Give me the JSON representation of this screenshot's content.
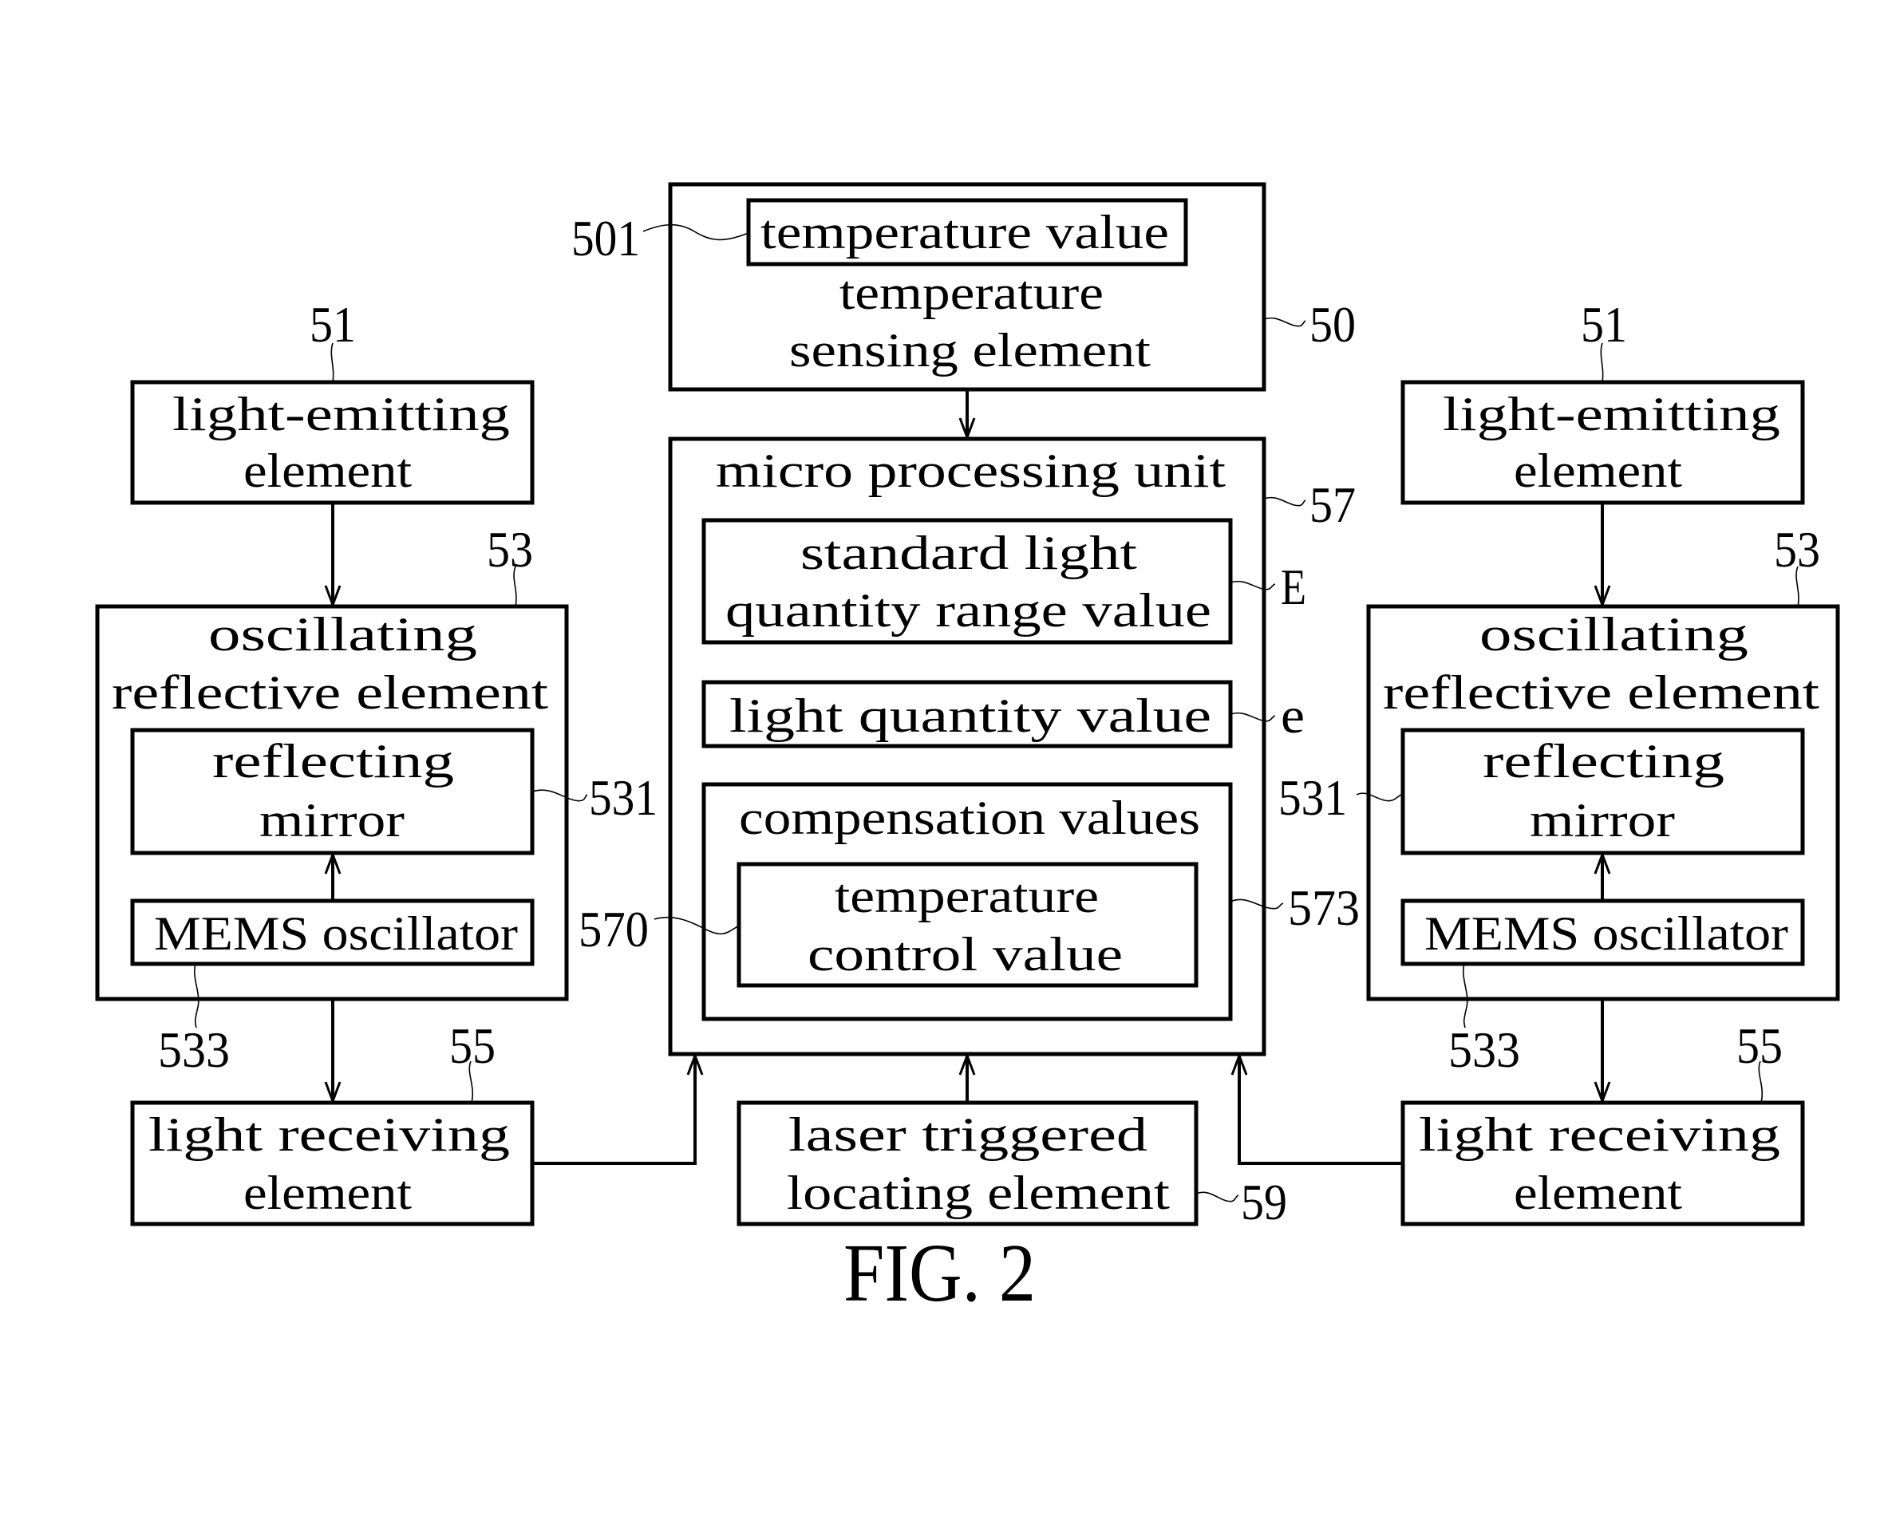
{
  "figure_caption": "FIG. 2",
  "temperature_sensing_element": {
    "ref": "50",
    "lines": [
      "temperature",
      "sensing element"
    ],
    "temperature_value": {
      "ref": "501",
      "label": "temperature value"
    }
  },
  "micro_processing_unit": {
    "ref": "57",
    "title": "micro processing unit",
    "standard_light_quantity_range_value": {
      "ref": "E",
      "lines": [
        "standard light",
        "quantity range value"
      ]
    },
    "light_quantity_value": {
      "ref": "e",
      "label": "light quantity value"
    },
    "compensation_values": {
      "ref": "573",
      "label": "compensation values",
      "temperature_control_value": {
        "ref": "570",
        "lines": [
          "temperature",
          "control value"
        ]
      }
    }
  },
  "laser_triggered_locating_element": {
    "ref": "59",
    "lines": [
      "laser triggered",
      "locating element"
    ]
  },
  "left_module": {
    "light_emitting_element": {
      "ref": "51",
      "lines": [
        "light-emitting",
        "element"
      ]
    },
    "oscillating_reflective_element": {
      "ref": "53",
      "lines": [
        "oscillating",
        "reflective element"
      ]
    },
    "reflecting_mirror": {
      "ref": "531",
      "lines": [
        "reflecting",
        "mirror"
      ]
    },
    "mems_oscillator": {
      "ref": "533",
      "label": "MEMS oscillator"
    },
    "light_receiving_element": {
      "ref": "55",
      "lines": [
        "light receiving",
        "element"
      ]
    }
  },
  "right_module": {
    "light_emitting_element": {
      "ref": "51",
      "lines": [
        "light-emitting",
        "element"
      ]
    },
    "oscillating_reflective_element": {
      "ref": "53",
      "lines": [
        "oscillating",
        "reflective element"
      ]
    },
    "reflecting_mirror": {
      "ref": "531",
      "lines": [
        "reflecting",
        "mirror"
      ]
    },
    "mems_oscillator": {
      "ref": "533",
      "label": "MEMS oscillator"
    },
    "light_receiving_element": {
      "ref": "55",
      "lines": [
        "light receiving",
        "element"
      ]
    }
  }
}
